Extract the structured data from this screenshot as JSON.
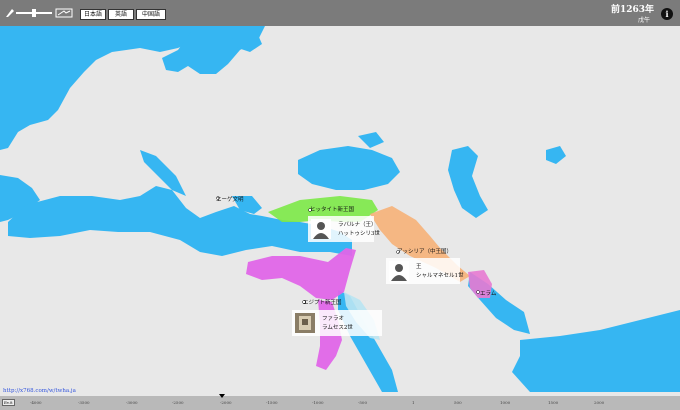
{
  "header": {
    "lang_buttons": [
      "日本語",
      "英語",
      "中国語"
    ],
    "year": "前1263年",
    "era": "戊午",
    "info_icon": "info-icon"
  },
  "map": {
    "labels": {
      "aegean": "エーゲ文明",
      "hittite": "ヒッタイト新王国",
      "assyria": "アッシリア（中王国）",
      "egypt": "エジプト新王国",
      "elam": "エラム"
    },
    "rulers": [
      {
        "title": "ラバルナ（王）",
        "name": "ハットゥシリ3世"
      },
      {
        "title": "王",
        "name": "シャルマネセル1世"
      },
      {
        "title": "ファラオ",
        "name": "ラムセス2世"
      }
    ],
    "colors": {
      "sea": "#36b6f2",
      "land": "#e6e6e6",
      "hittite": "#7ee84a",
      "assyria": "#f5b27a",
      "egypt": "#e066e8",
      "elam": "#e77ad2"
    }
  },
  "footer": {
    "url": "http://x768.com/w/twha.ja",
    "badge": "Ev.8",
    "ticks": [
      "-4000",
      "-3500",
      "-3000",
      "-2500",
      "-2000",
      "-1500",
      "-1000",
      "-500",
      "1",
      "500",
      "1000",
      "1500",
      "2000"
    ]
  }
}
